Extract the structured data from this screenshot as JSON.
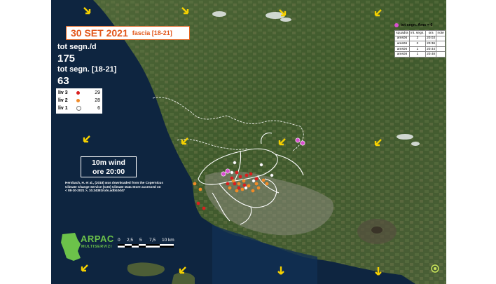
{
  "header": {
    "date": "30 SET 2021",
    "band": "fascia [18-21]"
  },
  "stats": {
    "daily_label": "tot segn./d",
    "daily_value": "175",
    "band_label": "tot segn. [18-21]",
    "band_value": "63"
  },
  "legend": [
    {
      "label": "liv 3",
      "count": "29",
      "color": "#d91f1f"
    },
    {
      "label": "liv 2",
      "count": "28",
      "color": "#f08a28"
    },
    {
      "label": "liv 1",
      "count": "6",
      "color": "#ffffff"
    }
  ],
  "wind": {
    "line1": "10m wind",
    "line2": "ore 20:00"
  },
  "credit": "Hersbach, H. et al., (2018) was downloaded from the Copernicus Climate Change Service (C3S) Climate Data Store accessed on < 08-10-2021 >, 10.24381/cds.adbb2d47",
  "ams": {
    "title": "tot segn. Ams = 6",
    "columns": [
      "squadra",
      "int. segn.",
      "ora",
      "note"
    ],
    "rows": [
      [
        "ams06",
        "2",
        "20:03",
        ""
      ],
      [
        "ams06",
        "2",
        "20:36",
        ""
      ],
      [
        "ams06",
        "1",
        "20:44",
        ""
      ],
      [
        "ams08",
        "1",
        "20:48",
        ""
      ]
    ],
    "color": "#d94fd0"
  },
  "scale": {
    "ticks": [
      "0",
      "2,5",
      "5",
      "7,5",
      "10 km"
    ]
  },
  "logo": {
    "name": "ARPAC",
    "sub": "MULTISERVIZI"
  },
  "colors": {
    "arrow": "#f5d000",
    "sea": "#0e2540",
    "land": "#3e5a2a",
    "boundary": "#ffffff",
    "date": "#e2581c"
  }
}
